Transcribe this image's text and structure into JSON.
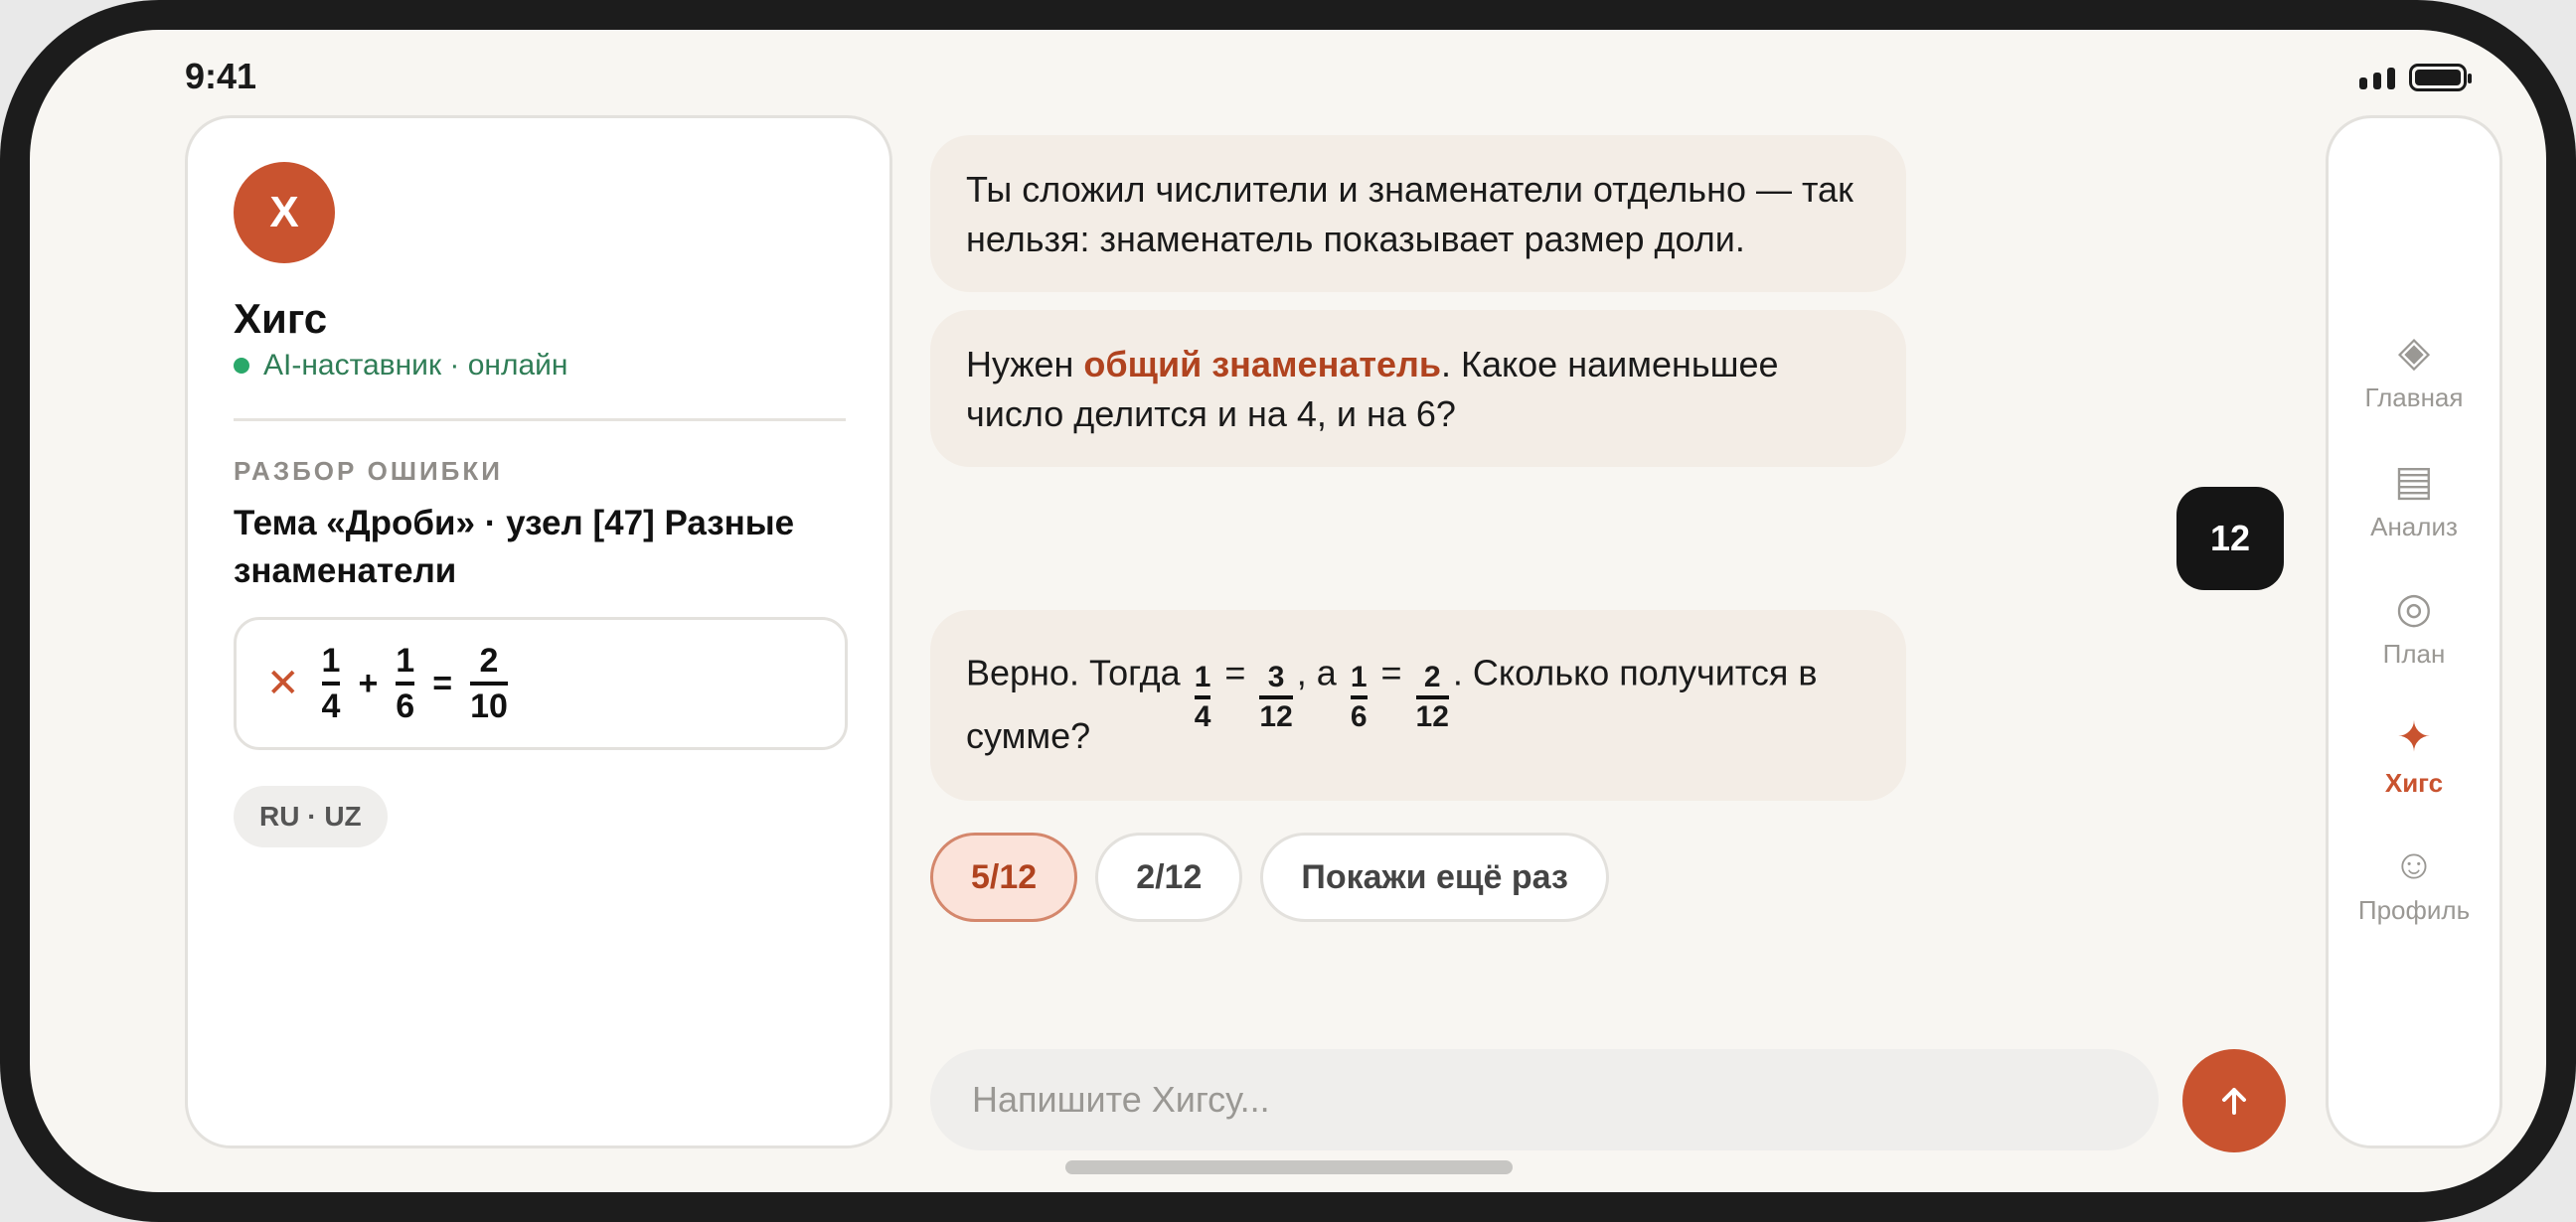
{
  "status_bar": {
    "time": "9:41"
  },
  "tutor": {
    "avatar_letter": "Х",
    "name": "Хигс",
    "status": "AI-наставник · онлайн"
  },
  "error_review": {
    "section_label": "РАЗБОР ОШИБКИ",
    "topic": "Тема «Дроби» · узел [47] Разные знаменатели",
    "wrong_mark": "✕",
    "formula": {
      "a_num": "1",
      "a_den": "4",
      "plus": "+",
      "b_num": "1",
      "b_den": "6",
      "equals": "=",
      "r_num": "2",
      "r_den": "10"
    },
    "language": "RU · UZ"
  },
  "messages": {
    "m1": "Ты сложил числители и знаменатели отдельно — так нельзя: знаменатель показывает размер доли.",
    "m2": {
      "before": "Нужен ",
      "highlight": "общий знаменатель",
      "after": ". Какое наименьшее число делится и на 4, и на 6?"
    },
    "user_reply": "12",
    "m3": {
      "before": "Верно. Тогда ",
      "f1_num": "1",
      "f1_den": "4",
      "eq1": " = ",
      "f2_num": "3",
      "f2_den": "12",
      "mid": ", а ",
      "f3_num": "1",
      "f3_den": "6",
      "eq2": " = ",
      "f4_num": "2",
      "f4_den": "12",
      "after": ". Сколько получится в сумме?"
    }
  },
  "quick_replies": [
    "5/12",
    "2/12",
    "Покажи ещё раз"
  ],
  "composer": {
    "placeholder": "Напишите Хигсу..."
  },
  "nav": [
    {
      "icon": "◈",
      "label": "Главная"
    },
    {
      "icon": "▤",
      "label": "Анализ"
    },
    {
      "icon": "◎",
      "label": "План"
    },
    {
      "icon": "✦",
      "label": "Хигс"
    },
    {
      "icon": "☺",
      "label": "Профиль"
    }
  ],
  "colors": {
    "accent": "#c9532f",
    "online": "#2aa86a",
    "bubble": "#f3ede6"
  }
}
